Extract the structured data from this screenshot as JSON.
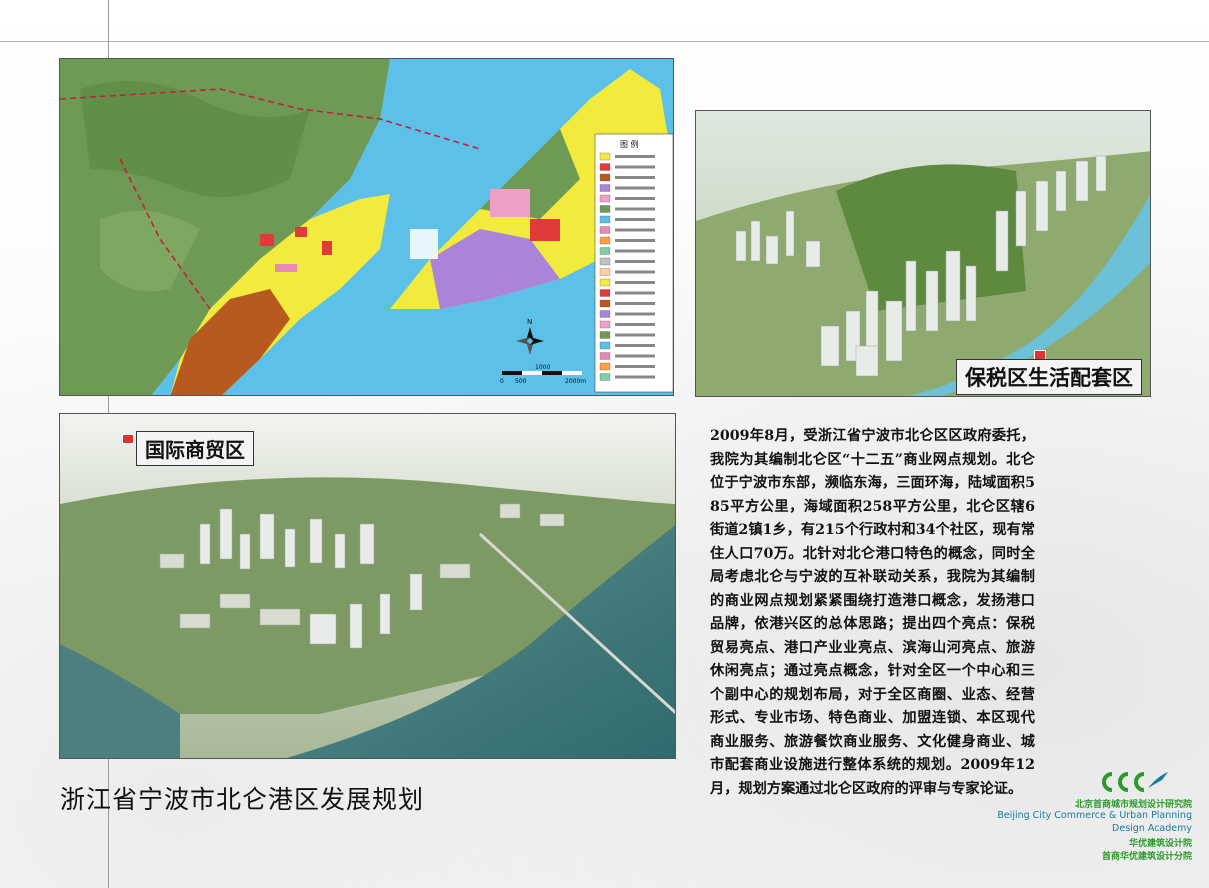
{
  "page": {
    "title": "浙江省宁波市北仑港区发展规划"
  },
  "panels": {
    "top_right_label": "保税区生活配套区",
    "bottom_left_label": "国际商贸区"
  },
  "description": "2009年8月，受浙江省宁波市北仑区区政府委托，我院为其编制北仑区“十二五”商业网点规划。北仑位于宁波市东部，濒临东海，三面环海，陆域面积585平方公里，海域面积258平方公里，北仑区辖6街道2镇1乡，有215个行政村和34个社区，现有常住人口70万。北针对北仑港口特色的概念，同时全局考虑北仑与宁波的互补联动关系，我院为其编制的商业网点规划紧紧围绕打造港口概念，发扬港口品牌，依港兴区的总体思路；提出四个亮点：保税贸易亮点、港口产业业亮点、滨海山河亮点、旅游休闲亮点；通过亮点概念，针对全区一个中心和三个副中心的规划布局，对于全区商圈、业态、经营形式、专业市场、特色商业、加盟连锁、本区现代商业服务、旅游餐饮商业服务、文化健身商业、城市配套商业设施进行整体系统的规划。2009年12月，规划方案通过北仑区政府的评审与专家论证。",
  "map": {
    "legend_title": "图 例",
    "north_label": "N",
    "scale_labels": [
      "0",
      "500",
      "1000",
      "2000m"
    ]
  },
  "logo": {
    "line1": "北京首商城市规划设计研究院",
    "line2": "Beijing City Commerce & Urban Planning",
    "line3": "Design Academy",
    "line4": "华优建筑设计院",
    "line5": "首商华优建筑设计分院"
  },
  "colors": {
    "sea": "#5cc0e8",
    "mountain": "#6f9a55",
    "residential": "#f2ea3c",
    "industrial": "#b85a20",
    "commercial": "#e03a3a",
    "warehouse": "#a984d8",
    "logo_green": "#2a9a2a",
    "logo_blue": "#1a7a9a"
  }
}
